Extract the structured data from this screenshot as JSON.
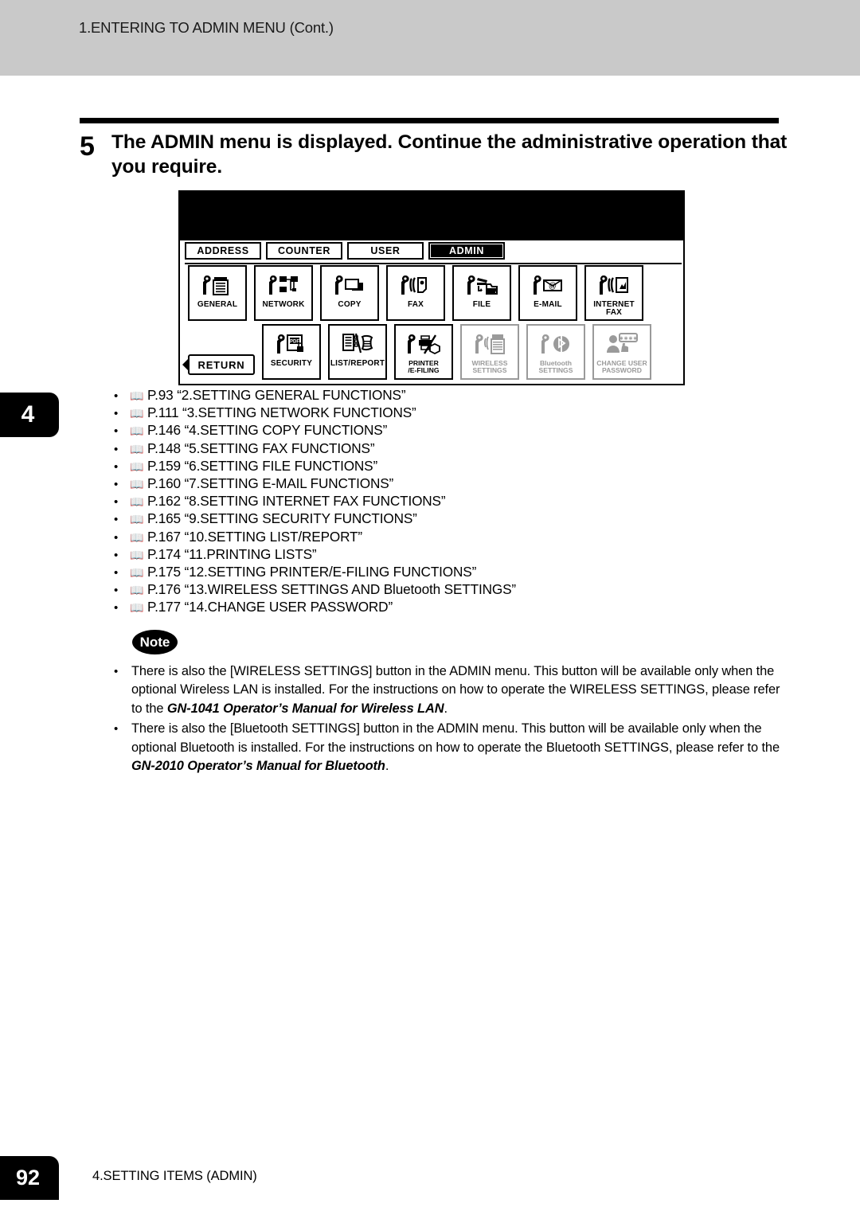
{
  "header": {
    "title": "1.ENTERING TO ADMIN MENU (Cont.)"
  },
  "chapter_tab": {
    "number": "4"
  },
  "step": {
    "number": "5",
    "text": "The ADMIN menu is displayed.  Continue the administrative operation that you require."
  },
  "lcd_panel": {
    "tabs": [
      {
        "label": "ADDRESS",
        "selected": false
      },
      {
        "label": "COUNTER",
        "selected": false
      },
      {
        "label": "USER",
        "selected": false
      },
      {
        "label": "ADMIN",
        "selected": true
      }
    ],
    "return_button": {
      "label": "RETURN",
      "icon": "back-arrow-icon"
    },
    "row1": [
      {
        "label": "GENERAL",
        "icon": "wrench-copier-icon",
        "enabled": true
      },
      {
        "label": "NETWORK",
        "icon": "wrench-network-icon",
        "enabled": true
      },
      {
        "label": "COPY",
        "icon": "wrench-copy-icon",
        "enabled": true
      },
      {
        "label": "FAX",
        "icon": "wrench-fax-icon",
        "enabled": true
      },
      {
        "label": "FILE",
        "icon": "wrench-file-icon",
        "enabled": true
      },
      {
        "label": "E-MAIL",
        "icon": "wrench-email-icon",
        "enabled": true
      },
      {
        "label": "INTERNET FAX",
        "icon": "wrench-internetfax-icon",
        "enabled": true
      }
    ],
    "row2": [
      {
        "label": "SECURITY",
        "icon": "wrench-pdf-lock-icon",
        "enabled": true
      },
      {
        "label": "LIST/REPORT",
        "icon": "list-report-icon",
        "enabled": true
      },
      {
        "label": "PRINTER\n/E-FILING",
        "icon": "wrench-printer-efiling-icon",
        "enabled": true
      },
      {
        "label": "WIRELESS\nSETTINGS",
        "icon": "wrench-wireless-icon",
        "enabled": false
      },
      {
        "label": "Bluetooth\nSETTINGS",
        "icon": "wrench-bluetooth-icon",
        "enabled": false
      },
      {
        "label": "CHANGE USER\nPASSWORD",
        "icon": "change-user-password-icon",
        "enabled": false
      }
    ]
  },
  "references": [
    {
      "page": "P.93",
      "title": "“2.SETTING GENERAL FUNCTIONS”"
    },
    {
      "page": "P.111",
      "title": "“3.SETTING NETWORK FUNCTIONS”"
    },
    {
      "page": "P.146",
      "title": "“4.SETTING COPY FUNCTIONS”"
    },
    {
      "page": "P.148",
      "title": "“5.SETTING FAX FUNCTIONS”"
    },
    {
      "page": "P.159",
      "title": "“6.SETTING FILE FUNCTIONS”"
    },
    {
      "page": "P.160",
      "title": "“7.SETTING E-MAIL FUNCTIONS”"
    },
    {
      "page": "P.162",
      "title": "“8.SETTING INTERNET FAX FUNCTIONS”"
    },
    {
      "page": "P.165",
      "title": "“9.SETTING SECURITY FUNCTIONS”"
    },
    {
      "page": "P.167",
      "title": "“10.SETTING LIST/REPORT”"
    },
    {
      "page": "P.174",
      "title": "“11.PRINTING LISTS”"
    },
    {
      "page": "P.175",
      "title": "“12.SETTING PRINTER/E-FILING FUNCTIONS”"
    },
    {
      "page": "P.176",
      "title": "“13.WIRELESS SETTINGS AND Bluetooth SETTINGS”"
    },
    {
      "page": "P.177",
      "title": "“14.CHANGE USER PASSWORD”"
    }
  ],
  "note": {
    "badge": "Note",
    "items": [
      {
        "lead": "There is also the [WIRELESS SETTINGS] button in the ADMIN menu.  This button will be available only when the optional Wireless LAN is installed.  For the instructions on how to operate the WIRELESS SETTINGS, please refer to the ",
        "emphasis": "GN-1041 Operator’s Manual for Wireless LAN",
        "tail": "."
      },
      {
        "lead": "There is also the [Bluetooth SETTINGS] button in the ADMIN menu.  This button will be available only when the optional Bluetooth is installed.  For the instructions on how to operate the Bluetooth SETTINGS, please refer to the ",
        "emphasis": "GN-2010 Operator’s Manual for Bluetooth",
        "tail": "."
      }
    ]
  },
  "footer": {
    "page_number": "92",
    "section": "4.SETTING ITEMS (ADMIN)"
  },
  "glyphs": {
    "book": "📖",
    "bullet": "•"
  }
}
